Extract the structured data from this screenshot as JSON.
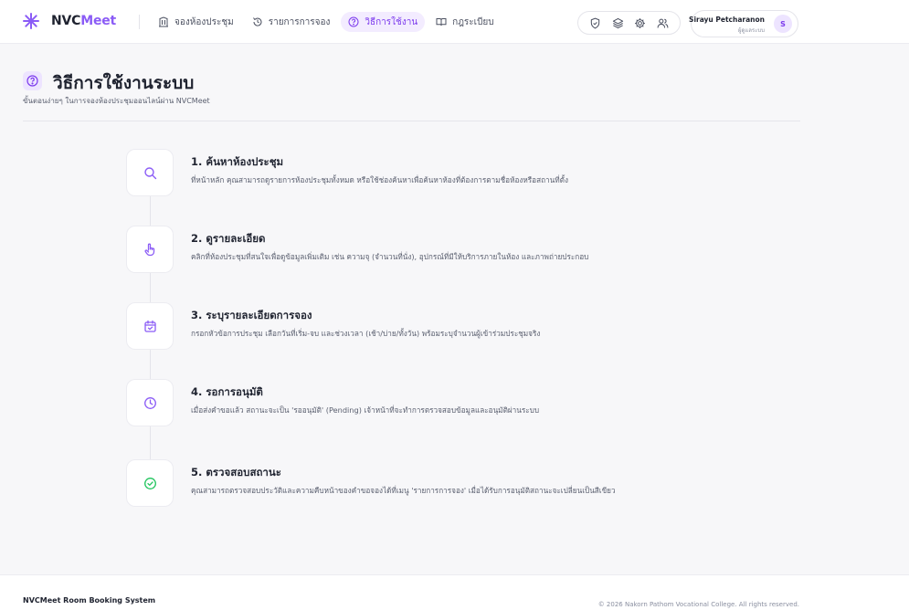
{
  "navbar": {
    "brand": {
      "name_part1": "NVC",
      "name_part2": "Meet",
      "icon": "logo-spark-icon"
    },
    "links": [
      {
        "label": "จองห้องประชุม",
        "icon": "building-icon",
        "active": false
      },
      {
        "label": "รายการการจอง",
        "icon": "history-icon",
        "active": false
      },
      {
        "label": "วิธีการใช้งาน",
        "icon": "help-circle-icon",
        "active": true
      },
      {
        "label": "กฎระเบียบ",
        "icon": "book-icon",
        "active": false
      }
    ],
    "icon_buttons": [
      "shield-icon",
      "layers-icon",
      "settings-icon",
      "users-icon"
    ],
    "user": {
      "name": "Sirayu Petcharanon",
      "role": "ผู้ดูแลระบบ",
      "initial": "S"
    }
  },
  "header": {
    "title": "วิธีการใช้งานระบบ",
    "subtitle": "ขั้นตอนง่ายๆ ในการจองห้องประชุมออนไลน์ผ่าน NVCMeet",
    "icon": "help-circle-icon"
  },
  "steps": [
    {
      "title": "1. ค้นหาห้องประชุม",
      "description": "ที่หน้าหลัก คุณสามารถดูรายการห้องประชุมทั้งหมด หรือใช้ช่องค้นหาเพื่อค้นหาห้องที่ต้องการตามชื่อห้องหรือสถานที่ตั้ง",
      "icon": "search-icon"
    },
    {
      "title": "2. ดูรายละเอียด",
      "description": "คลิกที่ห้องประชุมที่สนใจเพื่อดูข้อมูลเพิ่มเติม เช่น ความจุ (จำนวนที่นั่ง), อุปกรณ์ที่มีให้บริการภายในห้อง และภาพถ่ายประกอบ",
      "icon": "pointer-hand-icon"
    },
    {
      "title": "3. ระบุรายละเอียดการจอง",
      "description": "กรอกหัวข้อการประชุม เลือกวันที่เริ่ม-จบ และช่วงเวลา (เช้า/บ่าย/ทั้งวัน) พร้อมระบุจำนวนผู้เข้าร่วมประชุมจริง",
      "icon": "calendar-check-icon"
    },
    {
      "title": "4. รอการอนุมัติ",
      "description": "เมื่อส่งคำขอแล้ว สถานะจะเป็น 'รออนุมัติ' (Pending) เจ้าหน้าที่จะทำการตรวจสอบข้อมูลและอนุมัติผ่านระบบ",
      "icon": "clock-icon"
    },
    {
      "title": "5. ตรวจสอบสถานะ",
      "description": "คุณสามารถตรวจสอบประวัติและความคืบหน้าของคำขอจองได้ที่เมนู 'รายการการจอง' เมื่อได้รับการอนุมัติสถานะจะเปลี่ยนเป็นสีเขียว",
      "icon": "check-circle-icon"
    }
  ],
  "footer": {
    "brand": "NVCMeet Room Booking System",
    "copyright": "© 2026 Nakorn Pathom Vocational College. All rights reserved."
  },
  "colors": {
    "accent": "#8b5cf6",
    "accent_dark": "#7c3aed",
    "step_purple": "#8b5cf6",
    "step_green": "#22c55e"
  }
}
